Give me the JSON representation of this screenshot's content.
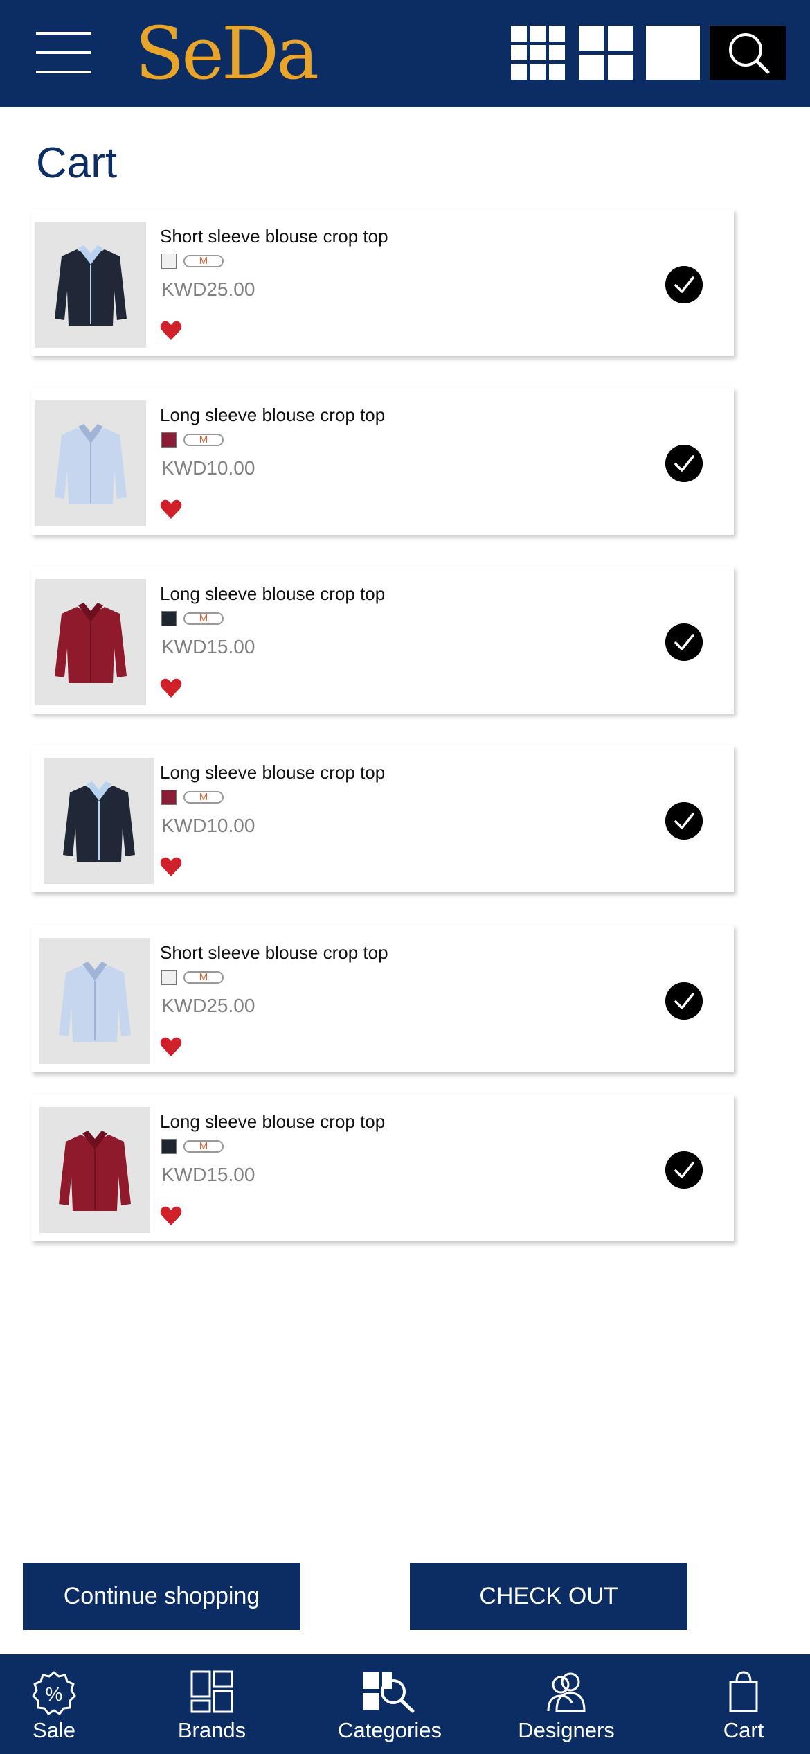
{
  "header": {
    "logo_text": "SeDa",
    "brand_color": "#e9a42a",
    "bar_color": "#0b2d63"
  },
  "view_options": [
    "grid-3x3-icon",
    "grid-2x2-icon",
    "single-view-icon",
    "search-icon"
  ],
  "page": {
    "title": "Cart"
  },
  "cart": {
    "items": [
      {
        "name": "Short sleeve blouse crop top",
        "color": "#f0f0f0",
        "size": "M",
        "price": "KWD25.00",
        "image": "navy-blazer"
      },
      {
        "name": "Long sleeve blouse crop top",
        "color": "#8b1e37",
        "size": "M",
        "price": "KWD10.00",
        "image": "light-blue-shirt"
      },
      {
        "name": "Long sleeve blouse crop top",
        "color": "#1f2630",
        "size": "M",
        "price": "KWD15.00",
        "image": "burgundy-blouse"
      },
      {
        "name": "Long sleeve blouse crop top",
        "color": "#8b1e37",
        "size": "M",
        "price": "KWD10.00",
        "image": "navy-blazer"
      },
      {
        "name": "Short sleeve blouse crop top",
        "color": "#f0f0f0",
        "size": "M",
        "price": "KWD25.00",
        "image": "light-blue-shirt"
      },
      {
        "name": "Long sleeve blouse crop top",
        "color": "#1f2630",
        "size": "M",
        "price": "KWD15.00",
        "image": "burgundy-blouse"
      }
    ]
  },
  "actions": {
    "continue_label": "Continue shopping",
    "checkout_label": "CHECK OUT"
  },
  "bottom_nav": {
    "sale": "Sale",
    "brands": "Brands",
    "categories": "Categories",
    "designers": "Designers",
    "cart": "Cart"
  }
}
